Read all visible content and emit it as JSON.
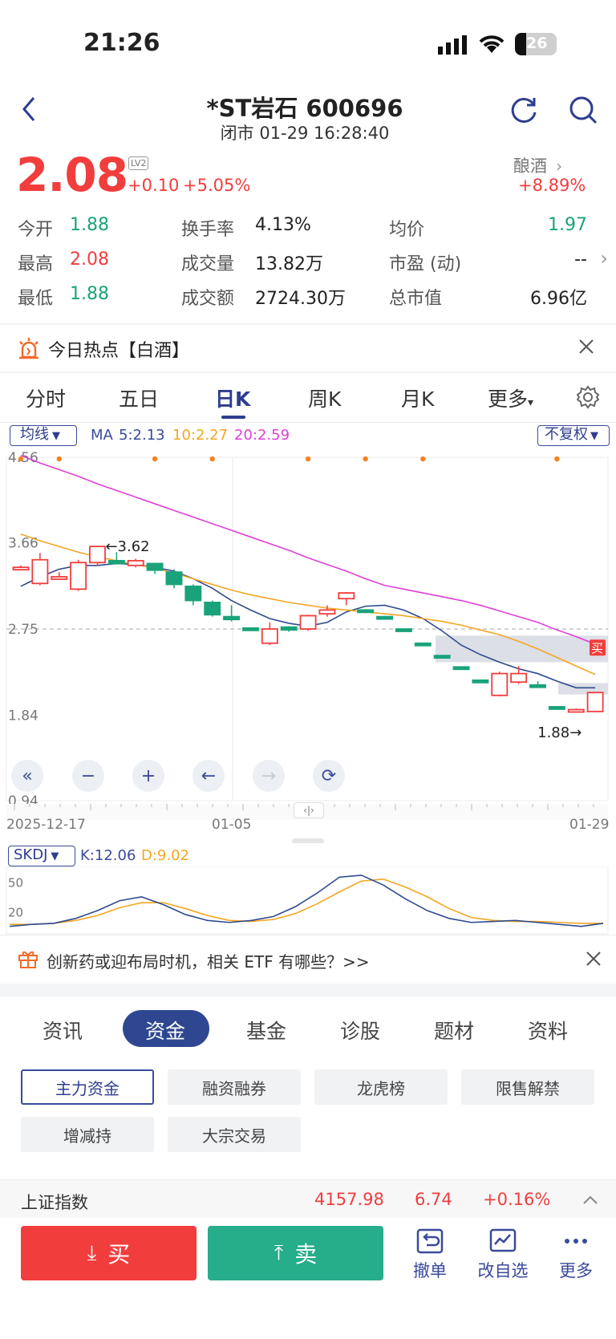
{
  "status_bar": {
    "time": "21:26",
    "battery": "26"
  },
  "header": {
    "title": "*ST岩石 600696",
    "subtitle": "闭市 01-29 16:28:40"
  },
  "quote": {
    "price": "2.08",
    "level_badge": "LV2",
    "change": "+0.10",
    "change_pct": "+5.05%",
    "sector": "酿酒",
    "sector_pct": "+8.89%"
  },
  "stats": [
    [
      {
        "label": "今开",
        "value": "1.88",
        "color": "green"
      },
      {
        "label": "换手率",
        "value": "4.13%",
        "color": "dark"
      },
      {
        "label": "均价",
        "value": "1.97",
        "color": "green"
      }
    ],
    [
      {
        "label": "最高",
        "value": "2.08",
        "color": "red"
      },
      {
        "label": "成交量",
        "value": "13.82万",
        "color": "dark"
      },
      {
        "label": "市盈 (动)",
        "value": "--",
        "color": "dark"
      }
    ],
    [
      {
        "label": "最低",
        "value": "1.88",
        "color": "green"
      },
      {
        "label": "成交额",
        "value": "2724.30万",
        "color": "dark"
      },
      {
        "label": "总市值",
        "value": "6.96亿",
        "color": "dark"
      }
    ]
  ],
  "hot_banner": {
    "text": "今日热点【白酒】"
  },
  "period_tabs": [
    "分时",
    "五日",
    "日K",
    "周K",
    "月K",
    "更多"
  ],
  "active_period": "日K",
  "ma_bar": {
    "dropdown": "均线",
    "ma_label": "MA",
    "ma5": "5:2.13",
    "ma10": "10:2.27",
    "ma20": "20:2.59",
    "adjust": "不复权"
  },
  "chart_data": {
    "type": "candlestick",
    "y_ticks": [
      "4.56",
      "3.66",
      "2.75",
      "1.84",
      "0.94"
    ],
    "ylim": [
      0.94,
      4.56
    ],
    "x_labels": [
      "2025-12-17",
      "01-05",
      "01-29"
    ],
    "annotations": {
      "high_label": "3.62",
      "low_label": "1.88",
      "buy_marker": "买"
    },
    "reference_line": 2.75,
    "candles": [
      {
        "o": 3.4,
        "c": 3.4,
        "h": 3.42,
        "l": 3.38
      },
      {
        "o": 3.23,
        "c": 3.48,
        "h": 3.55,
        "l": 3.21
      },
      {
        "o": 3.3,
        "c": 3.3,
        "h": 3.35,
        "l": 3.28
      },
      {
        "o": 3.17,
        "c": 3.45,
        "h": 3.48,
        "l": 3.15
      },
      {
        "o": 3.45,
        "c": 3.62,
        "h": 3.62,
        "l": 3.42
      },
      {
        "o": 3.47,
        "c": 3.44,
        "h": 3.56,
        "l": 3.43
      },
      {
        "o": 3.42,
        "c": 3.47,
        "h": 3.49,
        "l": 3.4
      },
      {
        "o": 3.44,
        "c": 3.37,
        "h": 3.44,
        "l": 3.33
      },
      {
        "o": 3.35,
        "c": 3.22,
        "h": 3.38,
        "l": 3.18
      },
      {
        "o": 3.2,
        "c": 3.05,
        "h": 3.22,
        "l": 3.0
      },
      {
        "o": 3.03,
        "c": 2.9,
        "h": 3.05,
        "l": 2.88
      },
      {
        "o": 2.88,
        "c": 2.85,
        "h": 3.0,
        "l": 2.83
      },
      {
        "o": 2.76,
        "c": 2.75,
        "h": 2.76,
        "l": 2.73
      },
      {
        "o": 2.6,
        "c": 2.75,
        "h": 2.82,
        "l": 2.58
      },
      {
        "o": 2.77,
        "c": 2.74,
        "h": 2.78,
        "l": 2.72
      },
      {
        "o": 2.75,
        "c": 2.89,
        "h": 2.9,
        "l": 2.73
      },
      {
        "o": 2.91,
        "c": 2.95,
        "h": 3.0,
        "l": 2.88
      },
      {
        "o": 3.07,
        "c": 3.13,
        "h": 3.14,
        "l": 3.0
      },
      {
        "o": 2.95,
        "c": 2.94,
        "h": 2.96,
        "l": 2.93
      },
      {
        "o": 2.88,
        "c": 2.86,
        "h": 2.89,
        "l": 2.85
      },
      {
        "o": 2.75,
        "c": 2.74,
        "h": 2.75,
        "l": 2.73
      },
      {
        "o": 2.6,
        "c": 2.59,
        "h": 2.6,
        "l": 2.58
      },
      {
        "o": 2.47,
        "c": 2.46,
        "h": 2.47,
        "l": 2.45
      },
      {
        "o": 2.35,
        "c": 2.34,
        "h": 2.35,
        "l": 2.33
      },
      {
        "o": 2.21,
        "c": 2.2,
        "h": 2.21,
        "l": 2.19
      },
      {
        "o": 2.05,
        "c": 2.28,
        "h": 2.3,
        "l": 2.04
      },
      {
        "o": 2.19,
        "c": 2.28,
        "h": 2.36,
        "l": 2.17
      },
      {
        "o": 2.16,
        "c": 2.15,
        "h": 2.2,
        "l": 2.14
      },
      {
        "o": 1.93,
        "c": 1.92,
        "h": 1.93,
        "l": 1.91
      },
      {
        "o": 1.9,
        "c": 1.9,
        "h": 1.91,
        "l": 1.88
      },
      {
        "o": 1.88,
        "c": 2.08,
        "h": 2.08,
        "l": 1.88
      }
    ],
    "series": [
      {
        "name": "MA5",
        "color": "#2e4a8f",
        "values": [
          3.2,
          3.3,
          3.38,
          3.42,
          3.42,
          3.44,
          3.43,
          3.4,
          3.36,
          3.28,
          3.18,
          3.05,
          2.95,
          2.86,
          2.81,
          2.78,
          2.82,
          2.93,
          2.99,
          3.0,
          2.95,
          2.86,
          2.73,
          2.58,
          2.48,
          2.4,
          2.33,
          2.28,
          2.2,
          2.13,
          2.13
        ]
      },
      {
        "name": "MA10",
        "color": "#f5a623",
        "values": [
          3.75,
          3.68,
          3.62,
          3.56,
          3.51,
          3.47,
          3.43,
          3.39,
          3.34,
          3.28,
          3.22,
          3.16,
          3.11,
          3.07,
          3.03,
          3.0,
          2.97,
          2.95,
          2.93,
          2.91,
          2.89,
          2.86,
          2.83,
          2.79,
          2.74,
          2.69,
          2.62,
          2.54,
          2.45,
          2.36,
          2.27
        ]
      },
      {
        "name": "MA20",
        "color": "#e040d6",
        "values": [
          4.58,
          4.5,
          4.43,
          4.36,
          4.28,
          4.21,
          4.14,
          4.07,
          4.0,
          3.93,
          3.86,
          3.79,
          3.72,
          3.65,
          3.58,
          3.5,
          3.43,
          3.36,
          3.28,
          3.21,
          3.17,
          3.13,
          3.09,
          3.05,
          3.0,
          2.94,
          2.88,
          2.82,
          2.74,
          2.67,
          2.59
        ]
      }
    ]
  },
  "chart_controls": [
    "first-icon",
    "zoom-out-icon",
    "zoom-in-icon",
    "prev-icon",
    "next-icon",
    "rotate-icon"
  ],
  "indicator": {
    "name": "SKDJ",
    "k_label": "K:12.06",
    "d_label": "D:9.02",
    "y_ticks": [
      "50",
      "20"
    ]
  },
  "indicator_data": {
    "k": [
      6,
      8,
      9,
      14,
      22,
      32,
      36,
      28,
      18,
      12,
      10,
      12,
      16,
      26,
      40,
      56,
      58,
      48,
      34,
      22,
      14,
      10,
      11,
      12,
      10,
      8,
      6,
      9
    ],
    "d": [
      8,
      8,
      9,
      12,
      17,
      25,
      30,
      30,
      24,
      17,
      12,
      11,
      13,
      19,
      29,
      41,
      52,
      54,
      46,
      36,
      24,
      15,
      12,
      11,
      11,
      10,
      9,
      9
    ]
  },
  "promo": {
    "text": "创新药或迎布局时机，相关 ETF 有哪些？>>"
  },
  "info_tabs": [
    "资讯",
    "资金",
    "基金",
    "诊股",
    "题材",
    "资料"
  ],
  "info_active": "资金",
  "chips": [
    "主力资金",
    "融资融券",
    "龙虎榜",
    "限售解禁",
    "增减持",
    "大宗交易"
  ],
  "index_bar": {
    "name": "上证指数",
    "value": "4157.98",
    "change": "6.74",
    "pct": "+0.16%"
  },
  "bottom": {
    "buy": "买",
    "sell": "卖",
    "cancel": "撤单",
    "edit_watch": "改自选",
    "more": "更多"
  },
  "colors": {
    "up": "#f23d3d",
    "down": "#1aa37b",
    "accent": "#3a4a9a"
  }
}
